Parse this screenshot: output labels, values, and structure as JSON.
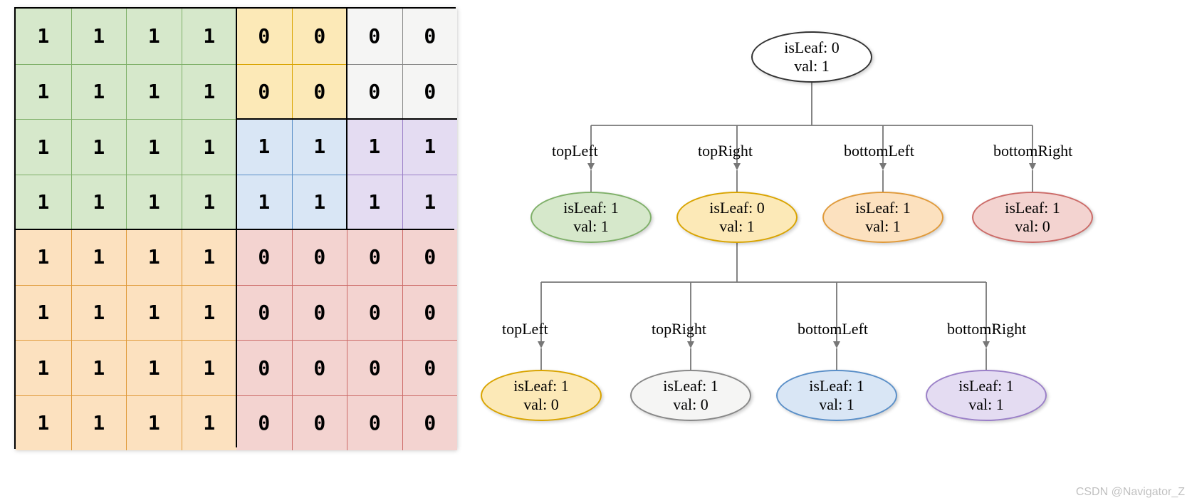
{
  "grid": {
    "size": 8,
    "values": [
      [
        1,
        1,
        1,
        1,
        0,
        0,
        0,
        0
      ],
      [
        1,
        1,
        1,
        1,
        0,
        0,
        0,
        0
      ],
      [
        1,
        1,
        1,
        1,
        1,
        1,
        1,
        1
      ],
      [
        1,
        1,
        1,
        1,
        1,
        1,
        1,
        1
      ],
      [
        1,
        1,
        1,
        1,
        0,
        0,
        0,
        0
      ],
      [
        1,
        1,
        1,
        1,
        0,
        0,
        0,
        0
      ],
      [
        1,
        1,
        1,
        1,
        0,
        0,
        0,
        0
      ],
      [
        1,
        1,
        1,
        1,
        0,
        0,
        0,
        0
      ]
    ],
    "regions": [
      {
        "name": "green",
        "r": 0,
        "c": 0,
        "rs": 4,
        "cs": 4,
        "fill": "#d6e8cb",
        "border": "#7fb069"
      },
      {
        "name": "yellow-tr",
        "r": 0,
        "c": 4,
        "rs": 2,
        "cs": 2,
        "fill": "#fce9b7",
        "border": "#d9a400"
      },
      {
        "name": "white-tr",
        "r": 0,
        "c": 6,
        "rs": 2,
        "cs": 2,
        "fill": "#f5f5f4",
        "border": "#888"
      },
      {
        "name": "blue-tr",
        "r": 2,
        "c": 4,
        "rs": 2,
        "cs": 2,
        "fill": "#d9e6f5",
        "border": "#5a8fc8"
      },
      {
        "name": "purple-tr",
        "r": 2,
        "c": 6,
        "rs": 2,
        "cs": 2,
        "fill": "#e4dcf2",
        "border": "#9b80c8"
      },
      {
        "name": "orange-bl",
        "r": 4,
        "c": 0,
        "rs": 4,
        "cs": 4,
        "fill": "#fce1bf",
        "border": "#e09a3a"
      },
      {
        "name": "red-br",
        "r": 4,
        "c": 4,
        "rs": 4,
        "cs": 4,
        "fill": "#f3d3d0",
        "border": "#cc6b68"
      }
    ]
  },
  "tree": {
    "labels": {
      "topLeft": "topLeft",
      "topRight": "topRight",
      "bottomLeft": "bottomLeft",
      "bottomRight": "bottomRight"
    },
    "root": {
      "isLeaf": 0,
      "val": 1,
      "fill": "#fff",
      "border": "#333"
    },
    "level1": [
      {
        "key": "topLeft",
        "isLeaf": 1,
        "val": 1,
        "fill": "#d6e8cb",
        "border": "#7fb069"
      },
      {
        "key": "topRight",
        "isLeaf": 0,
        "val": 1,
        "fill": "#fce9b7",
        "border": "#d9a400"
      },
      {
        "key": "bottomLeft",
        "isLeaf": 1,
        "val": 1,
        "fill": "#fce1bf",
        "border": "#e09a3a"
      },
      {
        "key": "bottomRight",
        "isLeaf": 1,
        "val": 0,
        "fill": "#f3d3d0",
        "border": "#cc6b68"
      }
    ],
    "level2": [
      {
        "key": "topLeft",
        "isLeaf": 1,
        "val": 0,
        "fill": "#fce9b7",
        "border": "#d9a400"
      },
      {
        "key": "topRight",
        "isLeaf": 1,
        "val": 0,
        "fill": "#f5f5f4",
        "border": "#888"
      },
      {
        "key": "bottomLeft",
        "isLeaf": 1,
        "val": 1,
        "fill": "#d9e6f5",
        "border": "#5a8fc8"
      },
      {
        "key": "bottomRight",
        "isLeaf": 1,
        "val": 1,
        "fill": "#e4dcf2",
        "border": "#9b80c8"
      }
    ]
  },
  "watermark": "CSDN @Navigator_Z"
}
